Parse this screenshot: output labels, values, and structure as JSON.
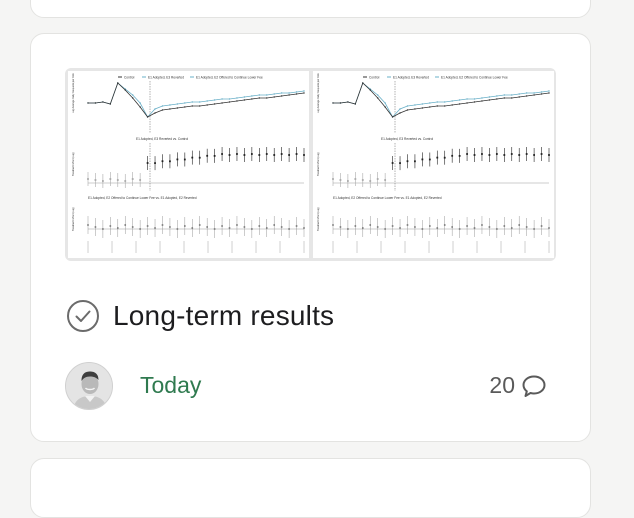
{
  "card": {
    "title": "Long-term results",
    "date": "Today",
    "comment_count": "20"
  },
  "thumbnail": {
    "legend": {
      "control": "Control",
      "e1": "E1 Adopted, E3 Reverted",
      "e2": "E1 Adopted, E2 Offered to Continue Lower Fee"
    },
    "panel_titles": {
      "middle": "E1 Adopted, E3 Reverted vs. Control",
      "bottom": "E1 Adopted, E2 Offered to Continue Lower Fee vs. E1 Adopted, E2 Reverted"
    }
  },
  "colors": {
    "date_green": "#2f7a4f",
    "series_dark": "#333333",
    "series_light": "#6ab0c8"
  },
  "icons": {
    "status": "check-circle-icon",
    "comments": "speech-bubble-icon"
  }
}
